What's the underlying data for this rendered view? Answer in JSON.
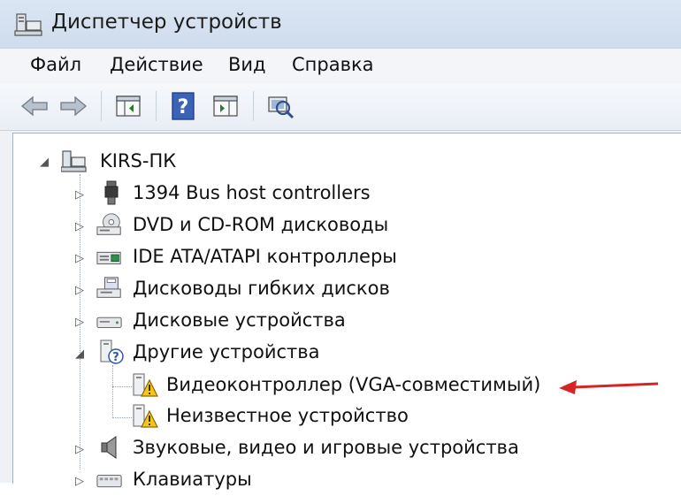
{
  "window": {
    "title": "Диспетчер устройств"
  },
  "menu": {
    "items": [
      {
        "label": "Файл"
      },
      {
        "label": "Действие"
      },
      {
        "label": "Вид"
      },
      {
        "label": "Справка"
      }
    ]
  },
  "toolbar": {
    "buttons": [
      {
        "icon": "back-arrow-icon"
      },
      {
        "icon": "forward-arrow-icon"
      },
      {
        "icon": "show-hide-console-tree-icon"
      },
      {
        "icon": "help-icon"
      },
      {
        "icon": "action-pane-icon"
      },
      {
        "icon": "scan-hardware-icon"
      }
    ]
  },
  "tree": {
    "root": {
      "label": "KIRS-ПК",
      "expander": "◢"
    },
    "items": [
      {
        "label": "1394 Bus host controllers",
        "icon": "usb-plug-icon",
        "expander": "▷"
      },
      {
        "label": "DVD и CD-ROM дисководы",
        "icon": "optical-drive-icon",
        "expander": "▷"
      },
      {
        "label": "IDE ATA/ATAPI контроллеры",
        "icon": "ide-controller-icon",
        "expander": "▷"
      },
      {
        "label": "Дисководы гибких дисков",
        "icon": "floppy-drive-icon",
        "expander": "▷"
      },
      {
        "label": "Дисковые устройства",
        "icon": "hard-disk-icon",
        "expander": "▷"
      },
      {
        "label": "Другие устройства",
        "icon": "unknown-device-icon",
        "expander": "◢",
        "children": [
          {
            "label": "Видеоконтроллер (VGA-совместимый)",
            "icon": "warning-device-icon"
          },
          {
            "label": "Неизвестное устройство",
            "icon": "warning-device-icon"
          }
        ]
      },
      {
        "label": "Звуковые, видео и игровые устройства",
        "icon": "speaker-icon",
        "expander": "▷"
      },
      {
        "label": "Клавиатуры",
        "icon": "keyboard-icon",
        "expander": "▷"
      }
    ]
  },
  "annotation": {
    "arrow_color": "#d42424"
  }
}
